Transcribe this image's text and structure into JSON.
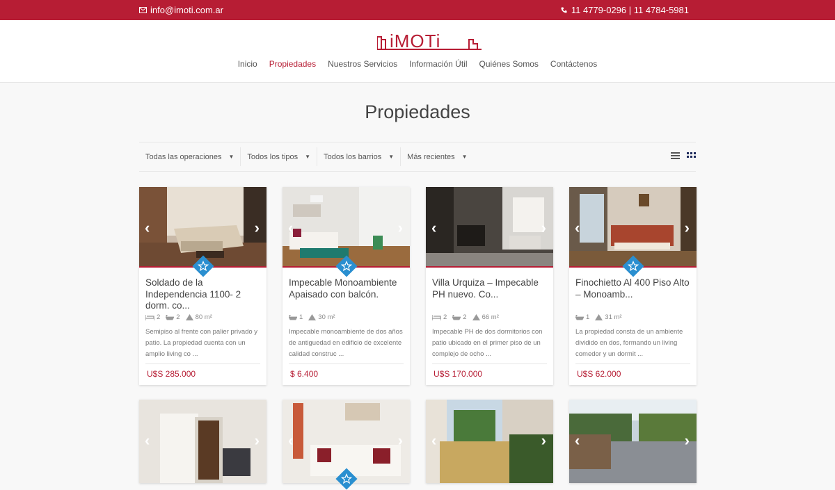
{
  "topbar": {
    "email": "info@imoti.com.ar",
    "phone": "11 4779-0296 | 11 4784-5981",
    "bg_color": "#b71d34"
  },
  "logo": {
    "text": "iMOTi"
  },
  "nav": {
    "items": [
      "Inicio",
      "Propiedades",
      "Nuestros Servicios",
      "Información Útil",
      "Quiénes Somos",
      "Contáctenos"
    ],
    "active": "Propiedades"
  },
  "page": {
    "title": "Propiedades"
  },
  "filters": {
    "operations": "Todas las operaciones",
    "types": "Todos los tipos",
    "neighborhoods": "Todos los barrios",
    "sort": "Más recientes"
  },
  "cards": [
    {
      "title": "Soldado de la Independencia 1100- 2 dorm. co...",
      "beds": "2",
      "baths": "2",
      "area": "80 m²",
      "desc": "Semipiso al frente con palier privado y patio. La propiedad cuenta con un amplio living co ...",
      "price": "U$S 285.000",
      "featured": true
    },
    {
      "title": "Impecable Monoambiente Apaisado con balcón.",
      "beds": "",
      "baths": "1",
      "area": "30 m²",
      "desc": "Impecable monoambiente de dos años de antiguedad en edificio de excelente calidad construc ...",
      "price": "$ 6.400",
      "featured": true
    },
    {
      "title": "Villa Urquiza – Impecable PH nuevo. Co...",
      "beds": "2",
      "baths": "2",
      "area": "66 m²",
      "desc": "Impecable PH de dos dormitorios con patio ubicado en el primer piso de un complejo de ocho ...",
      "price": "U$S 170.000",
      "featured": false
    },
    {
      "title": "Finochietto Al 400 Piso Alto – Monoamb...",
      "beds": "",
      "baths": "1",
      "area": "31 m²",
      "desc": "La propiedad consta de un ambiente dividido en dos, formando un living comedor y un dormit ...",
      "price": "U$S 62.000",
      "featured": true
    }
  ],
  "cards_row2": [
    {
      "featured": false
    },
    {
      "featured": true
    },
    {
      "featured": false
    },
    {
      "featured": false
    }
  ]
}
